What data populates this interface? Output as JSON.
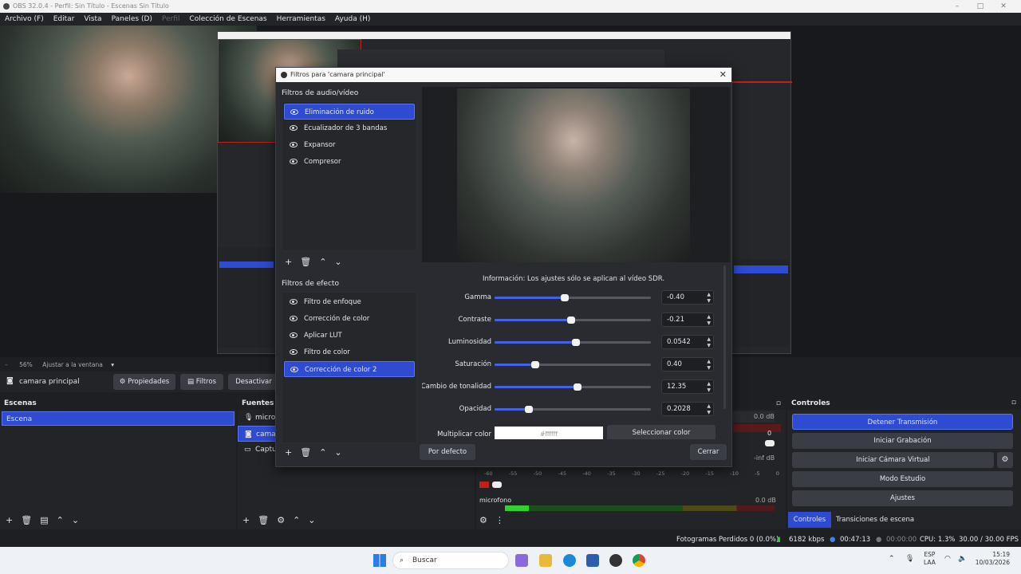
{
  "window": {
    "title": "OBS 32.0.4 - Perfil: Sin Título - Escenas Sin Título"
  },
  "menu": [
    "Archivo (F)",
    "Editar",
    "Vista",
    "Paneles (D)",
    "Perfil",
    "Colección de Escenas",
    "Herramientas",
    "Ayuda (H)"
  ],
  "preview": {
    "zoom": "56%",
    "fit_label": "Ajustar a la ventana"
  },
  "source_toolbar": {
    "source_name": "camara principal",
    "properties": "Propiedades",
    "filters": "Filtros",
    "deactivate": "Desactivar"
  },
  "dialog": {
    "title": "Filtros para 'camara principal'",
    "av_title": "Filtros de audio/vídeo",
    "av_filters": [
      "Eliminación de ruido",
      "Ecualizador de 3 bandas",
      "Expansor",
      "Compresor"
    ],
    "av_selected": 0,
    "fx_title": "Filtros de efecto",
    "fx_filters": [
      "Filtro de enfoque",
      "Corrección de color",
      "Aplicar LUT",
      "Filtro de color",
      "Corrección de color 2"
    ],
    "fx_selected": 4,
    "info": "Información: Los ajustes sólo se aplican al vídeo SDR.",
    "properties": [
      {
        "label": "Gamma",
        "value": "-0.40",
        "level": 0.45
      },
      {
        "label": "Contraste",
        "value": "-0.21",
        "level": 0.49
      },
      {
        "label": "Luminosidad",
        "value": "0.0542",
        "level": 0.52
      },
      {
        "label": "Saturación",
        "value": "0.40",
        "level": 0.26
      },
      {
        "label": "Cambio de tonalidad",
        "value": "12.35",
        "level": 0.53
      },
      {
        "label": "Opacidad",
        "value": "0.2028",
        "level": 0.22
      }
    ],
    "color_label": "Multiplicar color",
    "color_value": "#ffffff",
    "select_color": "Seleccionar color",
    "defaults": "Por defecto",
    "close": "Cerrar"
  },
  "scenes": {
    "title": "Escenas",
    "items": [
      "Escena"
    ]
  },
  "sources": {
    "title": "Fuentes",
    "items": [
      "microf",
      "camar",
      "Captur"
    ]
  },
  "mixer": {
    "db_top": "0.0 dB",
    "db_mid": "-inf dB",
    "ticks": [
      "-60",
      "-55",
      "-50",
      "-45",
      "-40",
      "-35",
      "-30",
      "-25",
      "-20",
      "-15",
      "-10",
      "-5",
      "0"
    ],
    "mic_label": "microfono",
    "mic_db": "0.0 dB",
    "small_zero": "0"
  },
  "controls": {
    "title": "Controles",
    "buttons": [
      "Detener Transmisión",
      "Iniciar Grabación",
      "Iniciar Cámara Virtual",
      "Modo Estudio",
      "Ajustes"
    ],
    "tabs": [
      "Controles",
      "Transiciones de escena"
    ]
  },
  "status": {
    "dropped": "Fotogramas Perdidos 0 (0.0%)",
    "bitrate": "6182 kbps",
    "stream_time": "00:47:13",
    "rec_time": "00:00:00",
    "cpu": "CPU: 1.3%",
    "fps": "30.00 / 30.00 FPS"
  },
  "taskbar": {
    "search": "Buscar",
    "lang1": "ESP",
    "lang2": "LAA",
    "time": "15:19",
    "date": "10/03/2026"
  },
  "colors": {
    "accent": "#2f4bd2",
    "bg": "#232428",
    "button": "#3b3d44",
    "selection_border": "#5a75f0"
  }
}
